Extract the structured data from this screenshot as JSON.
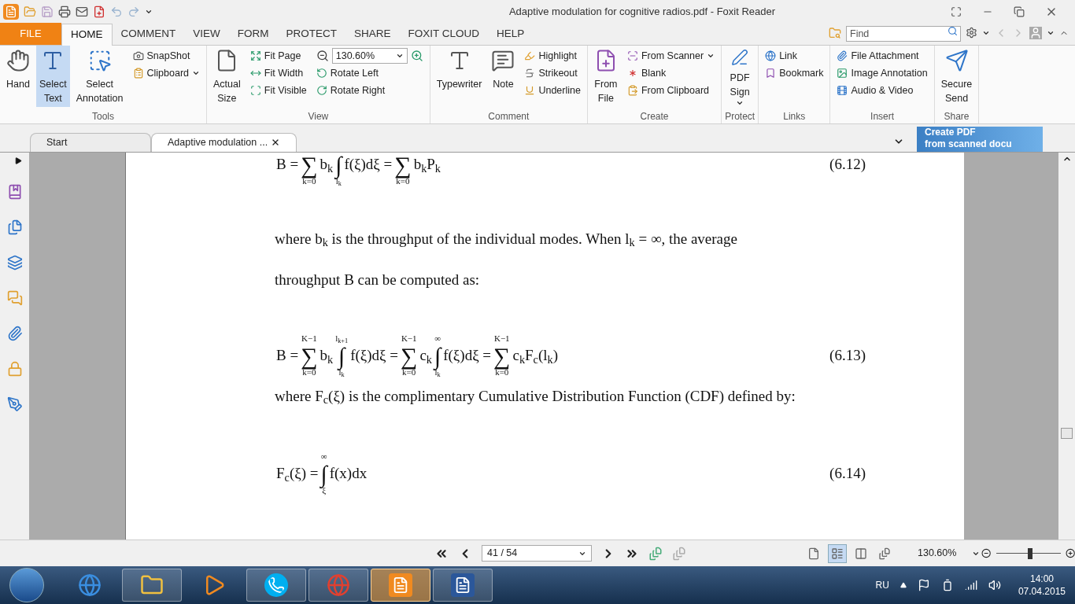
{
  "window": {
    "title": "Adaptive modulation for cognitive radios.pdf - Foxit Reader"
  },
  "menu_tabs": [
    {
      "label": "FILE",
      "kind": "file",
      "selected": false
    },
    {
      "label": "HOME",
      "kind": "tab",
      "selected": true
    },
    {
      "label": "COMMENT",
      "kind": "tab",
      "selected": false
    },
    {
      "label": "VIEW",
      "kind": "tab",
      "selected": false
    },
    {
      "label": "FORM",
      "kind": "tab",
      "selected": false
    },
    {
      "label": "PROTECT",
      "kind": "tab",
      "selected": false
    },
    {
      "label": "SHARE",
      "kind": "tab",
      "selected": false
    },
    {
      "label": "FOXIT CLOUD",
      "kind": "tab",
      "selected": false
    },
    {
      "label": "HELP",
      "kind": "tab",
      "selected": false
    }
  ],
  "search": {
    "placeholder": "Find"
  },
  "ribbon_groups": [
    {
      "label": "Tools",
      "items": [
        {
          "kind": "large",
          "label": "Hand",
          "selected": false
        },
        {
          "kind": "large",
          "label": "Select Text",
          "selected": true
        },
        {
          "kind": "large",
          "label": "Select Annotation",
          "selected": false
        },
        {
          "kind": "stack",
          "rows": [
            {
              "kind": "item",
              "label": "SnapShot"
            },
            {
              "kind": "item",
              "label": "Clipboard",
              "dropdown": true
            }
          ]
        }
      ]
    },
    {
      "label": "View",
      "items": [
        {
          "kind": "large",
          "label": "Actual Size"
        },
        {
          "kind": "stack",
          "rows": [
            {
              "kind": "item",
              "label": "Fit Page"
            },
            {
              "kind": "item",
              "label": "Fit Width"
            },
            {
              "kind": "item",
              "label": "Fit Visible"
            }
          ]
        },
        {
          "kind": "stack",
          "rows": [
            {
              "kind": "zoom",
              "value": "130.60%"
            },
            {
              "kind": "item",
              "label": "Rotate Left"
            },
            {
              "kind": "item",
              "label": "Rotate Right"
            }
          ]
        }
      ]
    },
    {
      "label": "Comment",
      "items": [
        {
          "kind": "large",
          "label": "Typewriter"
        },
        {
          "kind": "large",
          "label": "Note"
        },
        {
          "kind": "stack",
          "rows": [
            {
              "kind": "item",
              "label": "Highlight"
            },
            {
              "kind": "item",
              "label": "Strikeout"
            },
            {
              "kind": "item",
              "label": "Underline"
            }
          ]
        }
      ]
    },
    {
      "label": "Create",
      "items": [
        {
          "kind": "large",
          "label": "From File"
        },
        {
          "kind": "stack",
          "rows": [
            {
              "kind": "item",
              "label": "From Scanner",
              "dropdown": true
            },
            {
              "kind": "item",
              "label": "Blank"
            },
            {
              "kind": "item",
              "label": "From Clipboard"
            }
          ]
        }
      ]
    },
    {
      "label": "Protect",
      "items": [
        {
          "kind": "large",
          "label": "PDF Sign",
          "dropdown": true
        }
      ]
    },
    {
      "label": "Links",
      "items": [
        {
          "kind": "stack",
          "rows": [
            {
              "kind": "item",
              "label": "Link"
            },
            {
              "kind": "item",
              "label": "Bookmark"
            }
          ]
        }
      ]
    },
    {
      "label": "Insert",
      "items": [
        {
          "kind": "stack",
          "rows": [
            {
              "kind": "item",
              "label": "File Attachment"
            },
            {
              "kind": "item",
              "label": "Image Annotation"
            },
            {
              "kind": "item",
              "label": "Audio & Video"
            }
          ]
        }
      ]
    },
    {
      "label": "Share",
      "items": [
        {
          "kind": "large",
          "label": "Secure Send"
        }
      ]
    }
  ],
  "doc_tabs": [
    {
      "label": "Start",
      "selected": false,
      "closable": false
    },
    {
      "label": "Adaptive modulation ...",
      "selected": true,
      "closable": true
    }
  ],
  "promo_banner": {
    "lines": [
      "Create PDF",
      "from scanned docu"
    ]
  },
  "document": {
    "blocks": [
      {
        "kind": "equation",
        "number": "(6.12)",
        "parts": [
          {
            "kind": "text",
            "text": "B ="
          },
          {
            "kind": "op",
            "symbol": "∑",
            "lower": "k=0"
          },
          {
            "kind": "text",
            "text": "b$_{k}$"
          },
          {
            "kind": "op",
            "symbol": "∫",
            "lower": "l$_{k}$"
          },
          {
            "kind": "text",
            "text": "f(ξ)dξ ="
          },
          {
            "kind": "op",
            "symbol": "∑",
            "lower": "k=0"
          },
          {
            "kind": "text",
            "text": "b$_{k}$P$_{k}$"
          }
        ]
      },
      {
        "kind": "paragraph",
        "lines": [
          "where b$_{k}$ is the throughput of the individual modes. When l$_{k}$ = ∞, the average",
          "throughput B can be computed as:"
        ]
      },
      {
        "kind": "equation",
        "number": "(6.13)",
        "parts": [
          {
            "kind": "text",
            "text": "B ="
          },
          {
            "kind": "op",
            "symbol": "∑",
            "upper": "K−1",
            "lower": "k=0"
          },
          {
            "kind": "text",
            "text": "b$_{k}$"
          },
          {
            "kind": "op",
            "symbol": "∫",
            "upper": "l$_{k+1}$",
            "lower": "l$_{k}$"
          },
          {
            "kind": "text",
            "text": "f(ξ)dξ ="
          },
          {
            "kind": "op",
            "symbol": "∑",
            "upper": "K−1",
            "lower": "k=0"
          },
          {
            "kind": "text",
            "text": "c$_{k}$"
          },
          {
            "kind": "op",
            "symbol": "∫",
            "upper": "∞",
            "lower": "l$_{k}$"
          },
          {
            "kind": "text",
            "text": "f(ξ)dξ ="
          },
          {
            "kind": "op",
            "symbol": "∑",
            "upper": "K−1",
            "lower": "k=0"
          },
          {
            "kind": "text",
            "text": "c$_{k}$F$_{c}$(l$_{k}$)"
          }
        ]
      },
      {
        "kind": "paragraph",
        "lines": [
          "where F$_{c}$(ξ) is the complimentary Cumulative Distribution Function (CDF) defined by:"
        ]
      },
      {
        "kind": "equation",
        "number": "(6.14)",
        "parts": [
          {
            "kind": "text",
            "text": "F$_{c}$(ξ) ="
          },
          {
            "kind": "op",
            "symbol": "∫",
            "upper": "∞",
            "lower": "ξ"
          },
          {
            "kind": "text",
            "text": "f(x)dx"
          }
        ]
      }
    ]
  },
  "status_bar": {
    "page_field": "41 / 54",
    "view_modes": [
      {
        "selected": false
      },
      {
        "selected": true
      },
      {
        "selected": false
      },
      {
        "selected": false
      }
    ],
    "zoom": {
      "value": "130.60%",
      "level": 0.53
    }
  },
  "taskbar": {
    "apps": [
      {
        "running": false,
        "selected": false
      },
      {
        "running": true,
        "selected": false
      },
      {
        "running": false,
        "selected": false
      },
      {
        "running": true,
        "selected": false
      },
      {
        "running": true,
        "selected": false
      },
      {
        "running": true,
        "selected": true
      },
      {
        "running": true,
        "selected": false
      }
    ],
    "language": "RU",
    "time": "14:00",
    "date": "07.04.2015"
  }
}
